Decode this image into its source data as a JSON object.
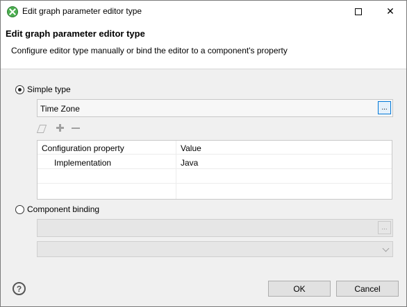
{
  "window": {
    "title": "Edit graph parameter editor type",
    "help_glyph": "?",
    "maximize_label": "",
    "close_glyph": "✕"
  },
  "header": {
    "title": "Edit graph parameter editor type",
    "description": "Configure editor type manually or bind the editor to a component's property"
  },
  "simple_type": {
    "label": "Simple type",
    "selected": true,
    "value": "Time Zone",
    "browse_label": "..."
  },
  "table": {
    "columns": [
      "Configuration property",
      "Value"
    ],
    "rows": [
      {
        "property": "Implementation",
        "value": "Java"
      }
    ]
  },
  "component_binding": {
    "label": "Component binding",
    "selected": false,
    "value": "",
    "browse_label": "..."
  },
  "footer": {
    "help_glyph": "?",
    "ok_label": "OK",
    "cancel_label": "Cancel"
  },
  "colors": {
    "accent": "#0078d7",
    "app_icon": "#4caf50"
  }
}
